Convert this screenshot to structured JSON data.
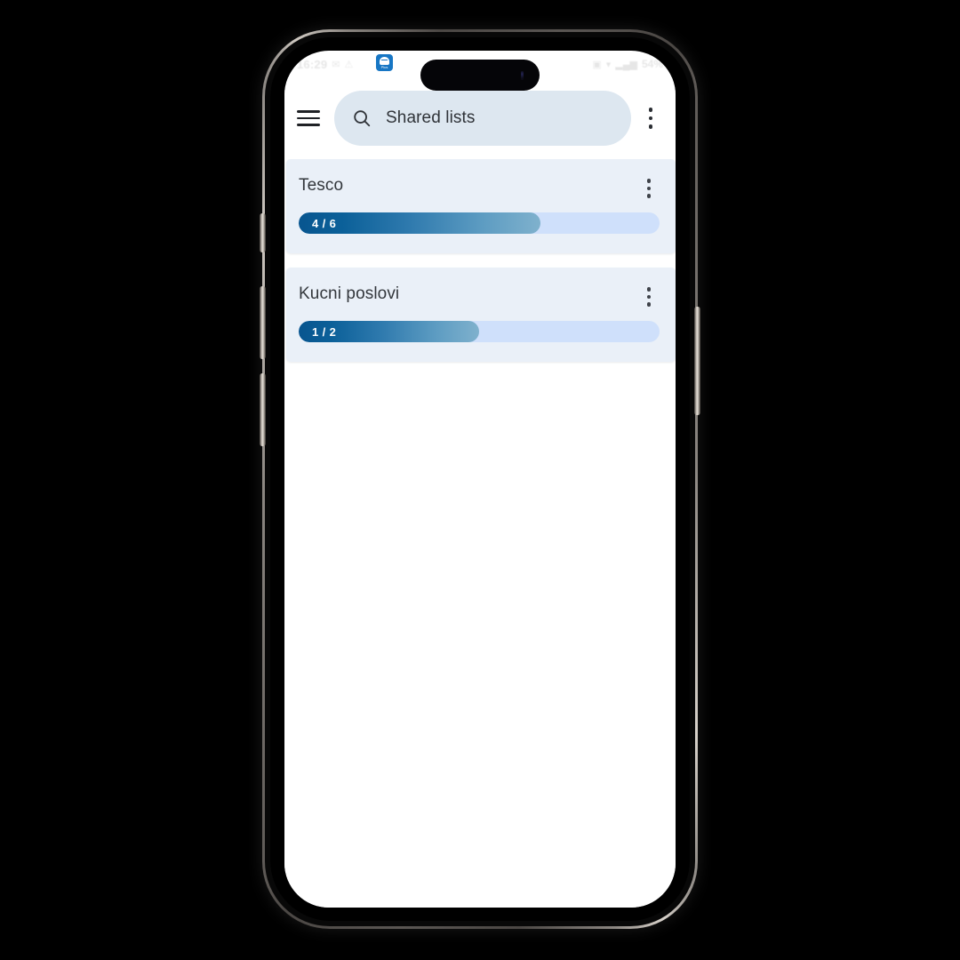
{
  "device": {
    "name": "smartphone-mockup",
    "status_bar": {
      "time": "16:29",
      "battery": "54%",
      "left_glyphs": [
        "✉",
        "⚠"
      ],
      "right_glyphs": [
        "▣",
        "▾",
        "▂▄▆"
      ],
      "app_icon_sublabel": "Plus"
    }
  },
  "appbar": {
    "menu_icon": "hamburger-icon",
    "search": {
      "icon": "search-icon",
      "value": "Shared lists",
      "placeholder": "Shared lists"
    },
    "overflow_icon": "more-vertical-icon"
  },
  "lists": [
    {
      "title": "Tesco",
      "progress_label": "4 / 6",
      "done": 4,
      "total": 6,
      "percent": 67,
      "overflow_icon": "more-vertical-icon"
    },
    {
      "title": "Kucni poslovi",
      "progress_label": "1 / 2",
      "done": 1,
      "total": 2,
      "percent": 50,
      "overflow_icon": "more-vertical-icon"
    }
  ],
  "colors": {
    "search_bar_bg": "#dde7f0",
    "card_bg": "#eaf0f8",
    "progress_track": "#cfe0fb",
    "progress_fill_start": "#08558f",
    "progress_fill_end": "#7fb1cd",
    "text_primary": "#33373c",
    "screen_bg": "#ffffff",
    "page_bg": "#000000"
  }
}
